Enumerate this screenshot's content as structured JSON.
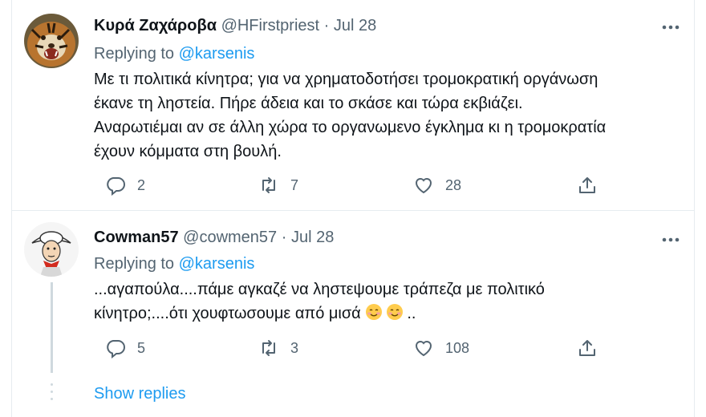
{
  "tweets": [
    {
      "name": "Κυρά Ζαχάροβα",
      "handle": "@HFirstpriest",
      "separator": "·",
      "date": "Jul 28",
      "replying_prefix": "Replying to ",
      "replying_to": "@karsenis",
      "text": "Με τι πολιτικά κίνητρα; για να χρηματοδοτήσει τρομοκρατική οργάνωση\nέκανε τη ληστεία. Πήρε άδεια και το σκάσε και τώρα εκβιάζει.\nΑναρωτιέμαι αν σε άλλη χώρα το οργανωμενο έγκλημα κι η τρομοκρατία\nέχουν κόμματα στη βουλή.",
      "replies": "2",
      "retweets": "7",
      "likes": "28",
      "avatar_icon": "tiger-avatar"
    },
    {
      "name": "Cowman57",
      "handle": "@cowmen57",
      "separator": "·",
      "date": "Jul 28",
      "replying_prefix": "Replying to ",
      "replying_to": "@karsenis",
      "text": "...αγαπούλα....πάμε αγκαζέ να ληστεψουμε τράπεζα με πολιτικό\nκίνητρο;....ότι χουφτωσουμε από μισά",
      "text_suffix": "..",
      "replies": "5",
      "retweets": "3",
      "likes": "108",
      "avatar_icon": "cartoon-cowboy-avatar"
    }
  ],
  "show_replies": "Show replies",
  "colors": {
    "accent": "#1d9bf0",
    "text": "#0f1419",
    "muted": "#536471",
    "border": "#e6ecf0"
  }
}
